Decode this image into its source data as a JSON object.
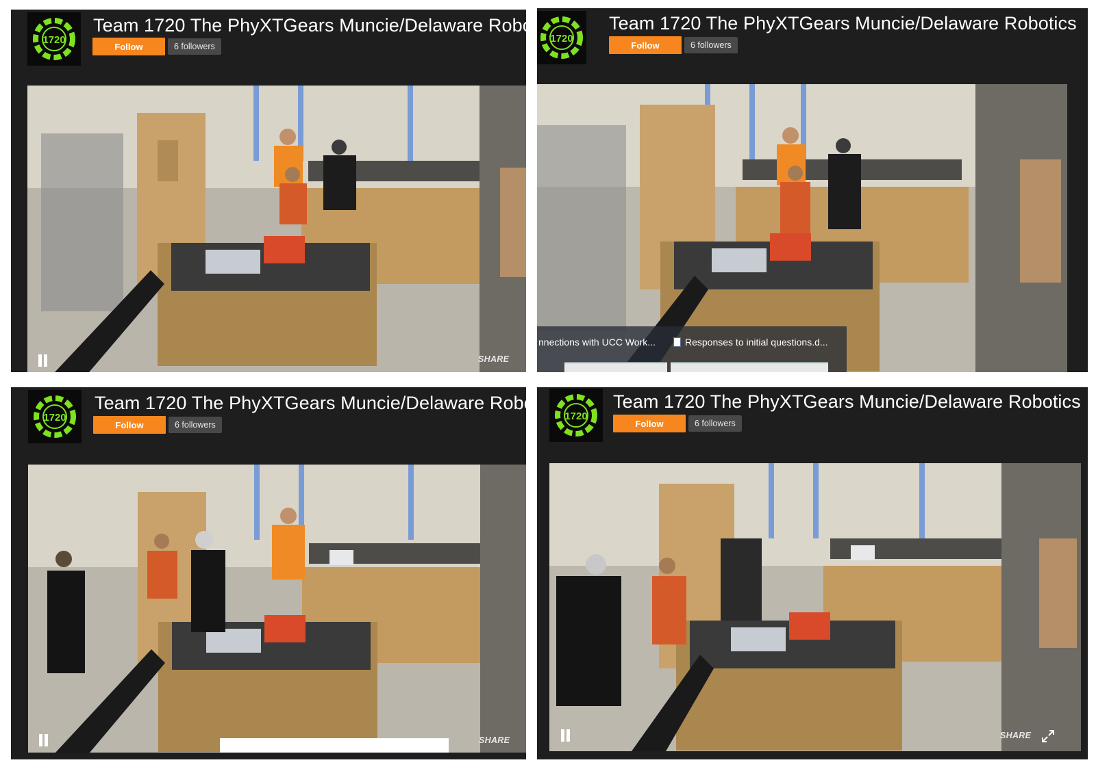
{
  "channel": {
    "title": "Team 1720 The PhyXTGears Muncie/Delaware Robotics",
    "logo_text": "1720",
    "follow_label": "Follow",
    "followers_label": "6 followers"
  },
  "player": {
    "share_label": "SHARE"
  },
  "taskbar": {
    "item1": "nnections with UCC Work...",
    "item2": "Responses to initial questions.d..."
  },
  "colors": {
    "accent_orange": "#f7861e",
    "logo_green": "#7ee21f",
    "panel_bg": "#1f1e1e"
  }
}
